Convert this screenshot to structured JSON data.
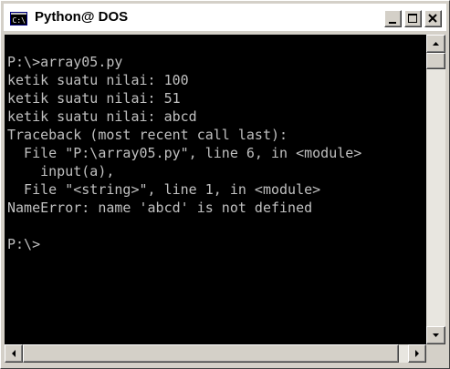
{
  "window": {
    "title": "Python@ DOS",
    "icon": "console-window-icon",
    "buttons": [
      "minimize-icon",
      "maximize-icon",
      "close-icon"
    ]
  },
  "console": {
    "lines": [
      "P:\\>array05.py",
      "ketik suatu nilai: 100",
      "ketik suatu nilai: 51",
      "ketik suatu nilai: abcd",
      "Traceback (most recent call last):",
      "  File \"P:\\array05.py\", line 6, in <module>",
      "    input(a),",
      "  File \"<string>\", line 1, in <module>",
      "NameError: name 'abcd' is not defined",
      "",
      "P:\\>"
    ]
  },
  "colors": {
    "console_background": "#000000",
    "console_text": "#c0c0c0",
    "titlebar": "#ffffff",
    "chrome": "#d4d0c8"
  }
}
